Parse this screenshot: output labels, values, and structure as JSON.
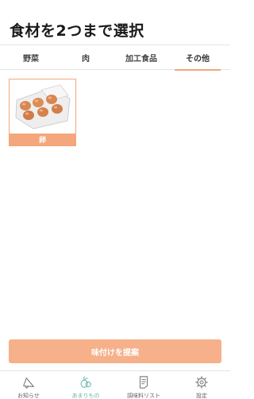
{
  "header": {
    "title": "食材を2つまで選択"
  },
  "tabs": [
    {
      "label": "野菜",
      "active": false
    },
    {
      "label": "肉",
      "active": false
    },
    {
      "label": "加工食品",
      "active": false
    },
    {
      "label": "その他",
      "active": true
    }
  ],
  "items": [
    {
      "label": "卵",
      "selected": true,
      "image": "egg-carton-icon"
    }
  ],
  "actions": {
    "suggest_label": "味付けを提案"
  },
  "nav": [
    {
      "label": "お知らせ",
      "icon": "megaphone-icon",
      "active": false
    },
    {
      "label": "あまりもの",
      "icon": "vegetables-icon",
      "active": true
    },
    {
      "label": "調味料リスト",
      "icon": "list-icon",
      "active": false
    },
    {
      "label": "設定",
      "icon": "gear-icon",
      "active": false
    }
  ],
  "colors": {
    "accent": "#f4a77c",
    "button": "#f6b08a",
    "nav_active": "#6bb8b0"
  }
}
